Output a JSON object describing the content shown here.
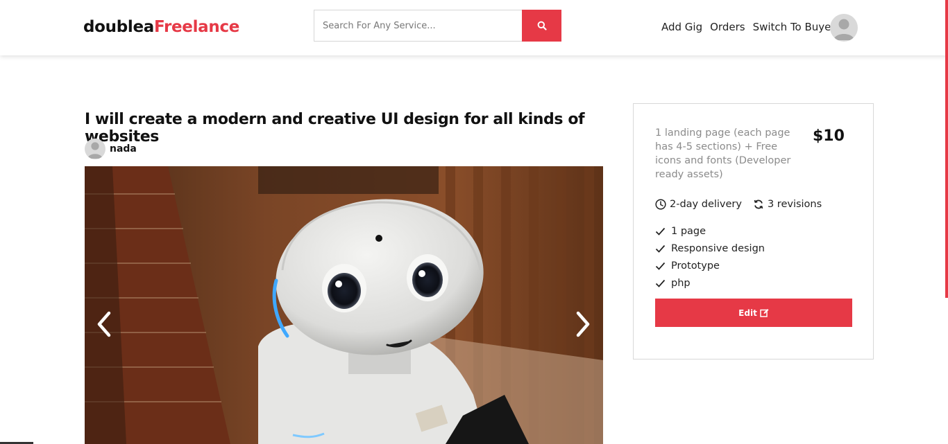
{
  "header": {
    "logo_primary": "doublea",
    "logo_accent": "Freelance",
    "search_placeholder": "Search For Any Service...",
    "nav": [
      "Add Gig",
      "Orders",
      "Switch To Buyer"
    ]
  },
  "gig": {
    "title": "I will create a modern and creative UI design for all kinds of websites",
    "seller_name": "nada"
  },
  "package": {
    "description": "1 landing page (each page has 4-5 sections) + Free icons and fonts (Developer ready assets)",
    "price": "$10",
    "delivery": "2-day delivery",
    "revisions": "3 revisions",
    "features": [
      "1 page",
      "Responsive design",
      "Prototype",
      "php"
    ],
    "edit_label": "Edit"
  },
  "colors": {
    "accent": "#e63946",
    "text": "#222222",
    "muted": "#8b8b8b"
  }
}
